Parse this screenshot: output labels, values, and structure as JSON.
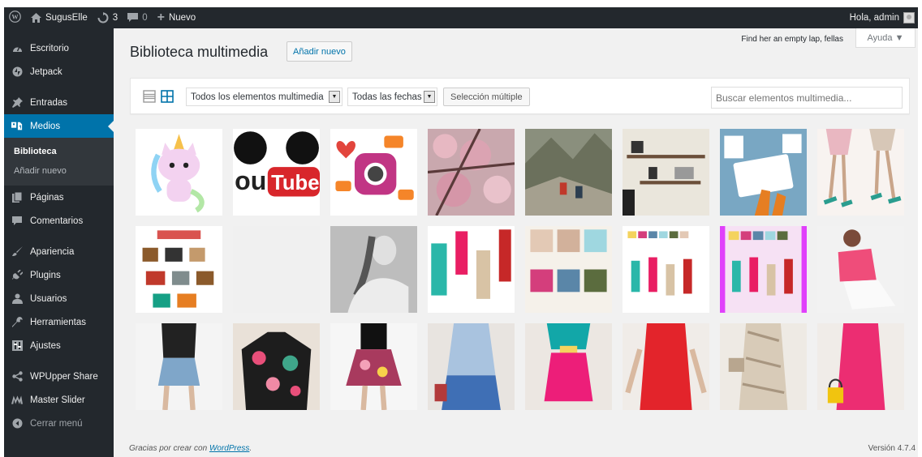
{
  "adminbar": {
    "site_name": "SugusElle",
    "updates_count": "3",
    "comments_count": "0",
    "new_label": "Nuevo",
    "greeting": "Hola, admin"
  },
  "sidebar": {
    "items": [
      {
        "label": "Escritorio",
        "icon": "dashboard-icon"
      },
      {
        "label": "Jetpack",
        "icon": "jetpack-icon"
      },
      {
        "label": "Entradas",
        "icon": "pin-icon"
      },
      {
        "label": "Medios",
        "icon": "media-icon"
      },
      {
        "label": "Páginas",
        "icon": "page-icon"
      },
      {
        "label": "Comentarios",
        "icon": "comment-icon"
      },
      {
        "label": "Apariencia",
        "icon": "brush-icon"
      },
      {
        "label": "Plugins",
        "icon": "plugin-icon"
      },
      {
        "label": "Usuarios",
        "icon": "users-icon"
      },
      {
        "label": "Herramientas",
        "icon": "wrench-icon"
      },
      {
        "label": "Ajustes",
        "icon": "settings-icon"
      },
      {
        "label": "WPUpper Share",
        "icon": "share-icon"
      },
      {
        "label": "Master Slider",
        "icon": "slider-icon"
      },
      {
        "label": "Cerrar menú",
        "icon": "collapse-icon"
      }
    ],
    "submenu": [
      "Biblioteca",
      "Añadir nuevo"
    ]
  },
  "header": {
    "hello_text": "Find her an empty lap, fellas",
    "help_label": "Ayuda ▼",
    "title": "Biblioteca multimedia",
    "add_new_label": "Añadir nuevo"
  },
  "toolbar": {
    "type_filter": "Todos los elementos multimedia",
    "date_filter": "Todas las fechas",
    "bulk_select_label": "Selección múltiple",
    "search_placeholder": "Buscar elementos multimedia..."
  },
  "media_items": [
    "unicorn-cat",
    "youtube-logo",
    "instagram-icons",
    "cherry-blossoms",
    "mountain-hikers",
    "wall-shelves",
    "hands-with-tablet",
    "fashion-sketch-legs",
    "retro-cameras",
    "blank",
    "woman-portrait-bw",
    "fashion-looks-collage",
    "pantone-palette",
    "color-palette-outfits",
    "color-palette-outfits-pink",
    "pink-top-model",
    "denim-skirt-outfit",
    "floral-sweater",
    "floral-skirt",
    "blue-dress-runway",
    "pink-teal-runway",
    "red-dress-runway",
    "beige-dress-clutch",
    "pink-dress-yellow-bag"
  ],
  "footer": {
    "thanks_prefix": "Gracias por crear con ",
    "thanks_link": "WordPress",
    "thanks_suffix": ".",
    "version": "Versión 4.7.4"
  },
  "colors": {
    "adminbar_bg": "#23282d",
    "accent": "#0073aa",
    "content_bg": "#f1f1f1"
  }
}
